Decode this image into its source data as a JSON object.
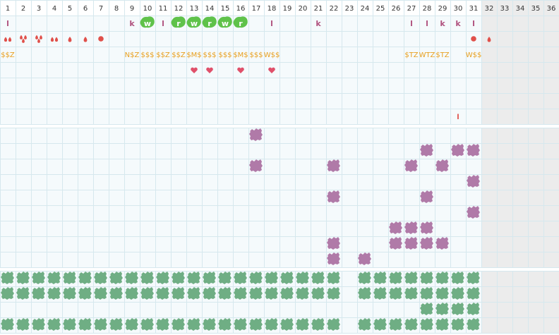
{
  "colors": {
    "grid_line": "#d6e8ee",
    "cell_bg": "#f5fafc",
    "header_bg": "#ffffff",
    "header_text": "#333333",
    "disabled_bg": "#ececec",
    "separator": "#ffffff",
    "letter": "#b0527f",
    "green_badge": "#5fc24a",
    "red_mark": "#e0504a",
    "gold_text": "#e8a020",
    "heart": "#e0506a",
    "purple_blob": "#b07aa8",
    "green_blob": "#6fae84"
  },
  "header": {
    "days": [
      "1",
      "2",
      "3",
      "4",
      "5",
      "6",
      "7",
      "8",
      "9",
      "10",
      "11",
      "12",
      "13",
      "14",
      "15",
      "16",
      "17",
      "18",
      "19",
      "20",
      "21",
      "22",
      "23",
      "24",
      "25",
      "26",
      "27",
      "28",
      "29",
      "30",
      "31",
      "32",
      "33",
      "34",
      "35",
      "36"
    ],
    "active_days": 31
  },
  "row_letters": [
    {
      "day": 1,
      "text": "l"
    },
    {
      "day": 9,
      "text": "k"
    },
    {
      "day": 11,
      "text": "l"
    },
    {
      "day": 18,
      "text": "l"
    },
    {
      "day": 21,
      "text": "k"
    },
    {
      "day": 27,
      "text": "l"
    },
    {
      "day": 28,
      "text": "l"
    },
    {
      "day": 29,
      "text": "k"
    },
    {
      "day": 30,
      "text": "k"
    },
    {
      "day": 31,
      "text": "l"
    }
  ],
  "row_badges": [
    {
      "day": 10,
      "text": "w"
    },
    {
      "day": 12,
      "text": "r"
    },
    {
      "day": 13,
      "text": "w"
    },
    {
      "day": 14,
      "text": "r"
    },
    {
      "day": 15,
      "text": "w"
    },
    {
      "day": 16,
      "text": "r"
    }
  ],
  "row_marks": [
    {
      "day": 1,
      "icon": "drops-2-icon"
    },
    {
      "day": 2,
      "icon": "drops-3-icon"
    },
    {
      "day": 3,
      "icon": "drops-3-icon"
    },
    {
      "day": 4,
      "icon": "drops-2-icon"
    },
    {
      "day": 5,
      "icon": "drop-icon"
    },
    {
      "day": 6,
      "icon": "drop-icon"
    },
    {
      "day": 7,
      "icon": "dot-icon"
    },
    {
      "day": 31,
      "icon": "dot-icon"
    },
    {
      "day": 32,
      "icon": "drop-icon"
    }
  ],
  "row_codes": [
    {
      "day": 1,
      "text": "$$Z"
    },
    {
      "day": 9,
      "text": "N$Z"
    },
    {
      "day": 10,
      "text": "$$$"
    },
    {
      "day": 11,
      "text": "$$Z"
    },
    {
      "day": 12,
      "text": "$$Z"
    },
    {
      "day": 13,
      "text": "$M$"
    },
    {
      "day": 14,
      "text": "$$$"
    },
    {
      "day": 15,
      "text": "$$$"
    },
    {
      "day": 16,
      "text": "$M$"
    },
    {
      "day": 17,
      "text": "$$$"
    },
    {
      "day": 18,
      "text": "W$$"
    },
    {
      "day": 27,
      "text": "$TZ"
    },
    {
      "day": 28,
      "text": "WTZ"
    },
    {
      "day": 29,
      "text": "$TZ"
    },
    {
      "day": 31,
      "text": "W$$"
    }
  ],
  "row_hearts": [
    13,
    14,
    16,
    18
  ],
  "row_tick": [
    {
      "day": 30,
      "text": "l"
    }
  ],
  "purple_blobs": [
    {
      "row": 0,
      "days": [
        17
      ]
    },
    {
      "row": 1,
      "days": [
        28,
        30,
        31
      ]
    },
    {
      "row": 2,
      "days": [
        17,
        22,
        27,
        29
      ]
    },
    {
      "row": 3,
      "days": [
        31
      ]
    },
    {
      "row": 4,
      "days": [
        22,
        28
      ]
    },
    {
      "row": 5,
      "days": [
        31
      ]
    },
    {
      "row": 6,
      "days": [
        26,
        27,
        28
      ]
    },
    {
      "row": 7,
      "days": [
        22,
        26,
        27,
        28,
        29
      ]
    },
    {
      "row": 8,
      "days": [
        22,
        24
      ]
    }
  ],
  "green_blobs": [
    {
      "row": 0,
      "days": [
        1,
        2,
        3,
        4,
        5,
        6,
        7,
        8,
        9,
        10,
        11,
        12,
        13,
        14,
        15,
        16,
        17,
        18,
        19,
        20,
        21,
        22,
        24,
        25,
        26,
        27,
        28,
        29,
        30,
        31
      ]
    },
    {
      "row": 1,
      "days": [
        1,
        2,
        3,
        4,
        5,
        6,
        7,
        8,
        9,
        10,
        11,
        12,
        13,
        14,
        15,
        16,
        17,
        18,
        19,
        20,
        21,
        22,
        24,
        25,
        26,
        27,
        28,
        29,
        30,
        31
      ]
    },
    {
      "row": 2,
      "days": [
        28,
        29,
        30,
        31
      ]
    },
    {
      "row": 3,
      "days": [
        1,
        2,
        3,
        4,
        5,
        6,
        7,
        8,
        9,
        10,
        11,
        12,
        13,
        14,
        15,
        16,
        17,
        18,
        19,
        20,
        21,
        22,
        24,
        25,
        26,
        27,
        28,
        29,
        30,
        31
      ]
    }
  ]
}
